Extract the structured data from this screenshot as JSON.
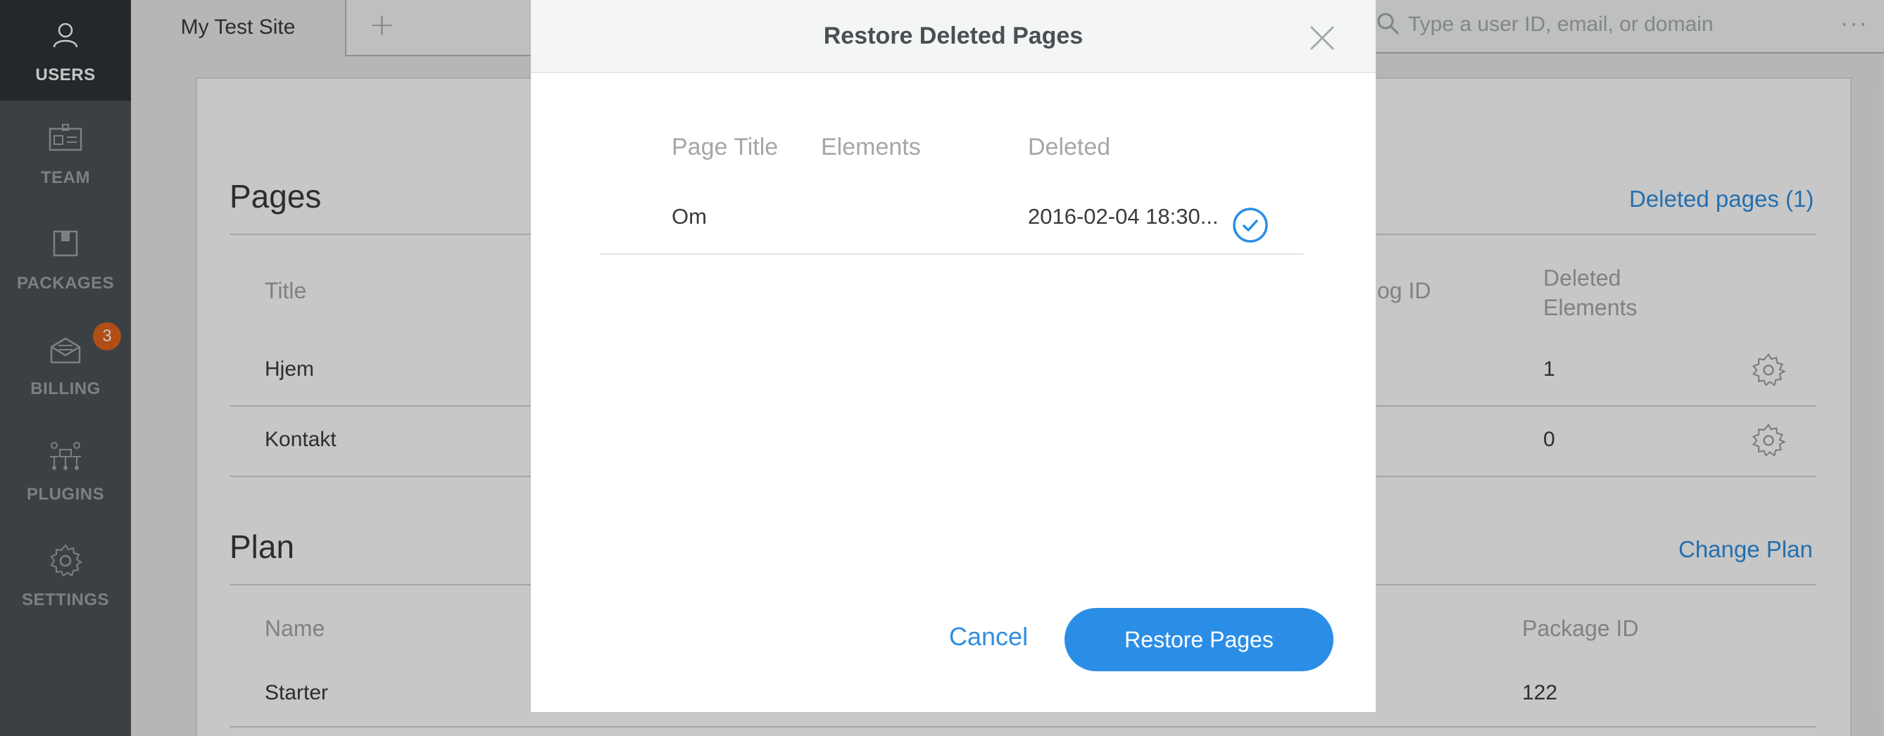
{
  "sidebar": {
    "items": [
      {
        "label": "USERS",
        "icon": "user-icon",
        "active": true
      },
      {
        "label": "TEAM",
        "icon": "id-card-icon"
      },
      {
        "label": "PACKAGES",
        "icon": "package-icon"
      },
      {
        "label": "BILLING",
        "icon": "envelope-icon",
        "badge": "3"
      },
      {
        "label": "PLUGINS",
        "icon": "plugins-icon"
      },
      {
        "label": "SETTINGS",
        "icon": "gear-icon"
      }
    ]
  },
  "topbar": {
    "site_tab": "My Test Site",
    "add_tab_symbol": "+",
    "search_placeholder": "Type a user ID, email, or domain",
    "more_symbol": "···"
  },
  "pages_section": {
    "title": "Pages",
    "deleted_link": "Deleted pages (1)",
    "columns": {
      "title": "Title",
      "blog_id": "og ID",
      "deleted_elements_1": "Deleted",
      "deleted_elements_2": "Elements"
    },
    "rows": [
      {
        "title": "Hjem",
        "deleted_elements": "1"
      },
      {
        "title": "Kontakt",
        "deleted_elements": "0"
      }
    ]
  },
  "plan_section": {
    "title": "Plan",
    "change_link": "Change Plan",
    "columns": {
      "name": "Name",
      "package_id": "Package ID"
    },
    "rows": [
      {
        "name": "Starter",
        "package_id": "122"
      }
    ]
  },
  "modal": {
    "title": "Restore Deleted Pages",
    "columns": {
      "page_title": "Page Title",
      "elements": "Elements",
      "deleted": "Deleted"
    },
    "rows": [
      {
        "page_title": "Om",
        "elements": "",
        "deleted": "2016-02-04 18:30...",
        "selected": true
      }
    ],
    "cancel_label": "Cancel",
    "restore_label": "Restore Pages"
  },
  "colors": {
    "sidebar": "#4b5258",
    "sidebar_active": "#2f3438",
    "accent": "#2b8ee6",
    "badge": "#e2651c"
  }
}
